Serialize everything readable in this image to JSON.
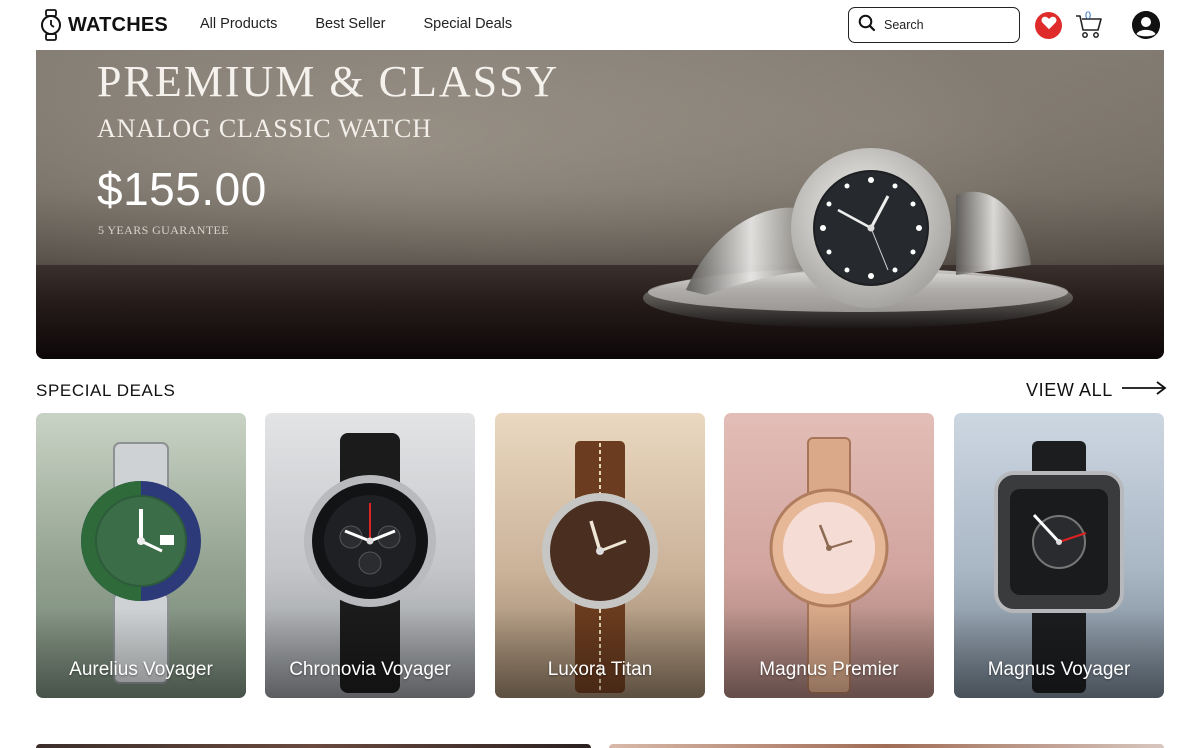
{
  "header": {
    "logo_text": "WATCHES",
    "nav": [
      "All Products",
      "Best Seller",
      "Special Deals"
    ],
    "search_placeholder": "Search",
    "cart_count": "0"
  },
  "hero": {
    "title": "PREMIUM & CLASSY",
    "subtitle": "ANALOG CLASSIC WATCH",
    "price": "$155.00",
    "guarantee": "5 YEARS GUARANTEE"
  },
  "deals": {
    "title": "SPECIAL DEALS",
    "view_all": "VIEW ALL",
    "items": [
      {
        "name": "Aurelius Voyager",
        "bg": "#9aa896"
      },
      {
        "name": "Chronovia Voyager",
        "bg": "#c9cbcf"
      },
      {
        "name": "Luxora Titan",
        "bg": "#cdb59a"
      },
      {
        "name": "Magnus Premier",
        "bg": "#d4a8a2"
      },
      {
        "name": "Magnus Voyager",
        "bg": "#a9b6c4"
      }
    ]
  },
  "colors": {
    "heart": "#e02b2b",
    "cart_count": "#2a6fb5",
    "text": "#111111"
  },
  "icons": [
    "watch-logo-icon",
    "search-icon",
    "heart-icon",
    "cart-icon",
    "user-icon",
    "arrow-right-icon"
  ]
}
